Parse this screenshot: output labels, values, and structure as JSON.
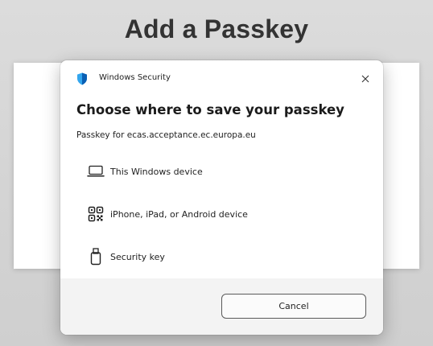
{
  "page": {
    "heading": "Add a Passkey"
  },
  "dialog": {
    "app_title": "Windows Security",
    "heading": "Choose where to save your passkey",
    "subtext": "Passkey for ecas.acceptance.ec.europa.eu",
    "options": [
      {
        "label": "This Windows device",
        "icon": "laptop-icon"
      },
      {
        "label": "iPhone, iPad, or Android device",
        "icon": "qr-code-icon"
      },
      {
        "label": "Security key",
        "icon": "usb-key-icon"
      }
    ],
    "cancel_label": "Cancel",
    "close_icon": "close-icon",
    "shield_icon": "shield-icon"
  },
  "colors": {
    "shield_light": "#33a6ee",
    "shield_dark": "#0a5fb4",
    "heading_text": "#333333",
    "footer_bg": "#f3f3f3"
  }
}
